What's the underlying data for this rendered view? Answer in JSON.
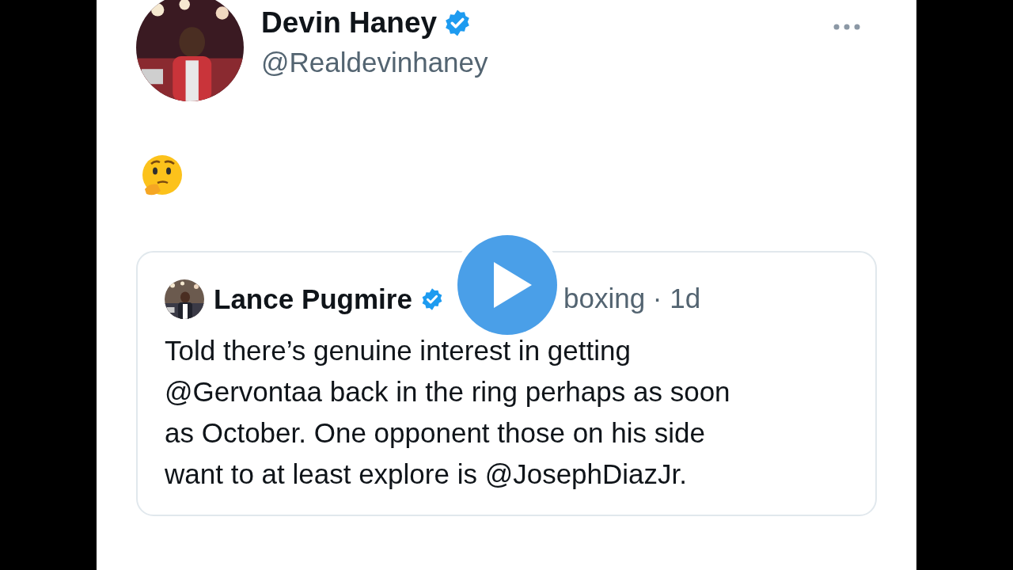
{
  "tweet": {
    "author_name": "Devin Haney",
    "author_handle": "@Realdevinhaney",
    "quoted_tweet": {
      "author_name": "Lance Pugmire",
      "handle_and_time": "boxing · 1d",
      "text_lines": [
        "Told there’s genuine interest in getting",
        "@Gervontaa back in the ring perhaps as soon",
        "as October. One opponent those on his side",
        "want to at least explore is @JosephDiazJr."
      ]
    }
  }
}
